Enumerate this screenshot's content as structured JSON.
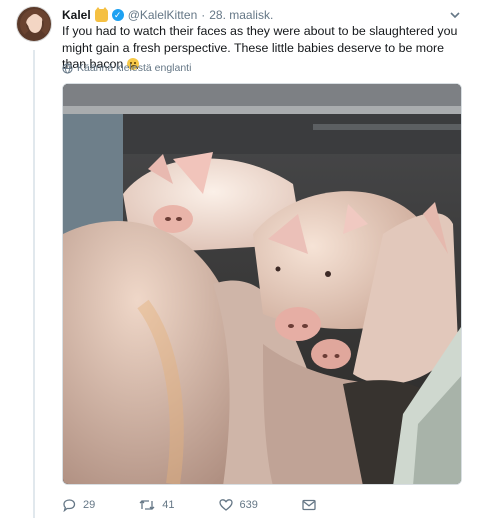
{
  "tweet": {
    "author_name": "Kalel",
    "author_handle": "@KalelKitten",
    "separator": "·",
    "date": "28. maalisk.",
    "text": "If you had to watch their faces as they were about to be slaughtered you might gain a fresh perspective. These little babies deserve to be more than bacon",
    "translate_label": "Käännä kielestä englanti",
    "media_description_icon": "photo-of-pigs-in-truck",
    "accent_color": "#1da1f2"
  },
  "actions": {
    "replies": "29",
    "retweets": "41",
    "likes": "639"
  }
}
